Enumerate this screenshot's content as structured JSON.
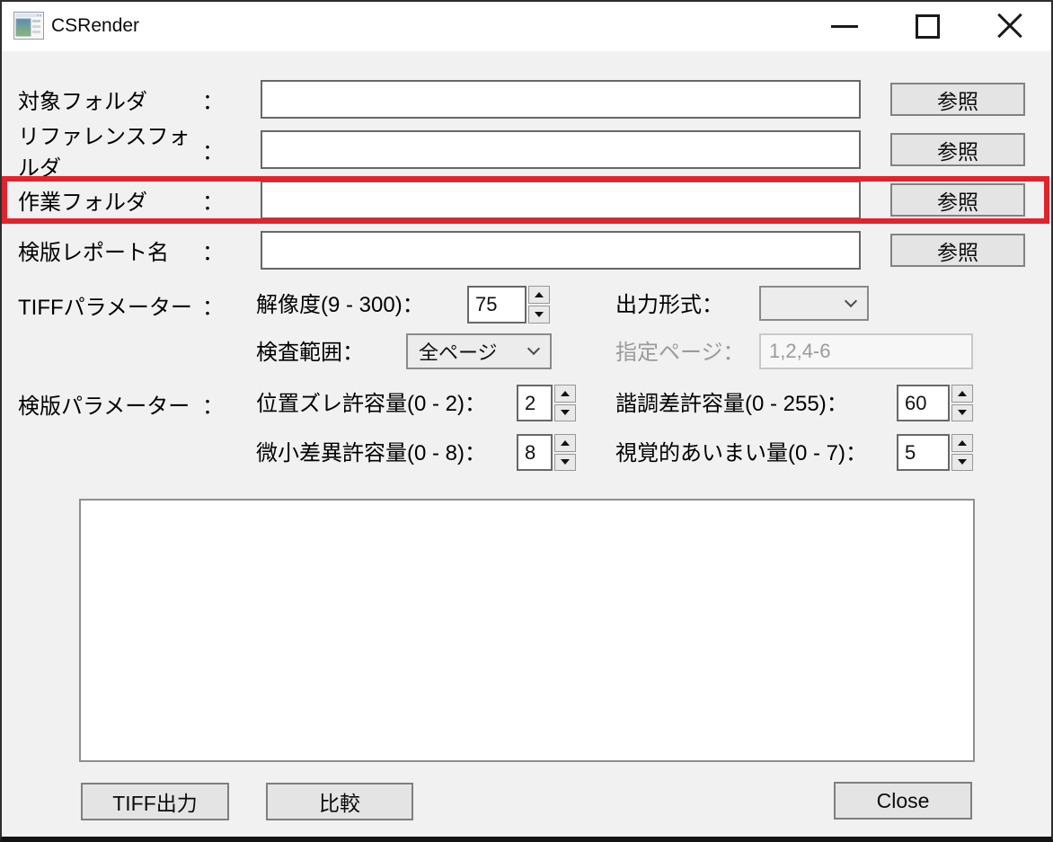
{
  "window": {
    "title": "CSRender",
    "app_icon": "application-window-icon",
    "controls": {
      "minimize": "minimize",
      "maximize": "maximize",
      "close": "close"
    }
  },
  "colors": {
    "highlight_red": "#e2232b",
    "titlebar_bg": "#ffffff",
    "form_bg": "#f1f1f1",
    "button_bg": "#e4e4e4",
    "disabled_text": "#9b9b9b"
  },
  "folder_rows": [
    {
      "label": "対象フォルダ",
      "colon": "：",
      "value": "",
      "browse_label": "参照",
      "highlighted": false
    },
    {
      "label": "リファレンスフォルダ",
      "colon": "：",
      "value": "",
      "browse_label": "参照",
      "highlighted": false
    },
    {
      "label": "作業フォルダ",
      "colon": "：",
      "value": "",
      "browse_label": "参照",
      "highlighted": true
    },
    {
      "label": "検版レポート名",
      "colon": "：",
      "value": "",
      "browse_label": "参照",
      "highlighted": false
    }
  ],
  "tiff_section": {
    "label": "TIFFパラメーター",
    "colon": "：",
    "resolution": {
      "label": "解像度(9 - 300)：",
      "value": "75",
      "min": 9,
      "max": 300
    },
    "output_format": {
      "label": "出力形式：",
      "value": ""
    },
    "scan_range": {
      "label": "検査範囲：",
      "value": "全ページ"
    },
    "page_spec": {
      "label": "指定ページ：",
      "value": "1,2,4-6",
      "disabled": true
    }
  },
  "inspect_section": {
    "label": "検版パラメーター",
    "colon": "：",
    "position_tolerance": {
      "label": "位置ズレ許容量(0 - 2)：",
      "value": "2",
      "min": 0,
      "max": 2
    },
    "gradation_tolerance": {
      "label": "諧調差許容量(0 - 255)：",
      "value": "60",
      "min": 0,
      "max": 255
    },
    "minor_diff_tolerance": {
      "label": "微小差異許容量(0 - 8)：",
      "value": "8",
      "min": 0,
      "max": 8
    },
    "visual_ambiguity": {
      "label": "視覚的あいまい量(0 - 7)：",
      "value": "5",
      "min": 0,
      "max": 7
    }
  },
  "log_area": {
    "value": ""
  },
  "footer": {
    "tiff_output_label": "TIFF出力",
    "compare_label": "比較",
    "close_label": "Close"
  }
}
